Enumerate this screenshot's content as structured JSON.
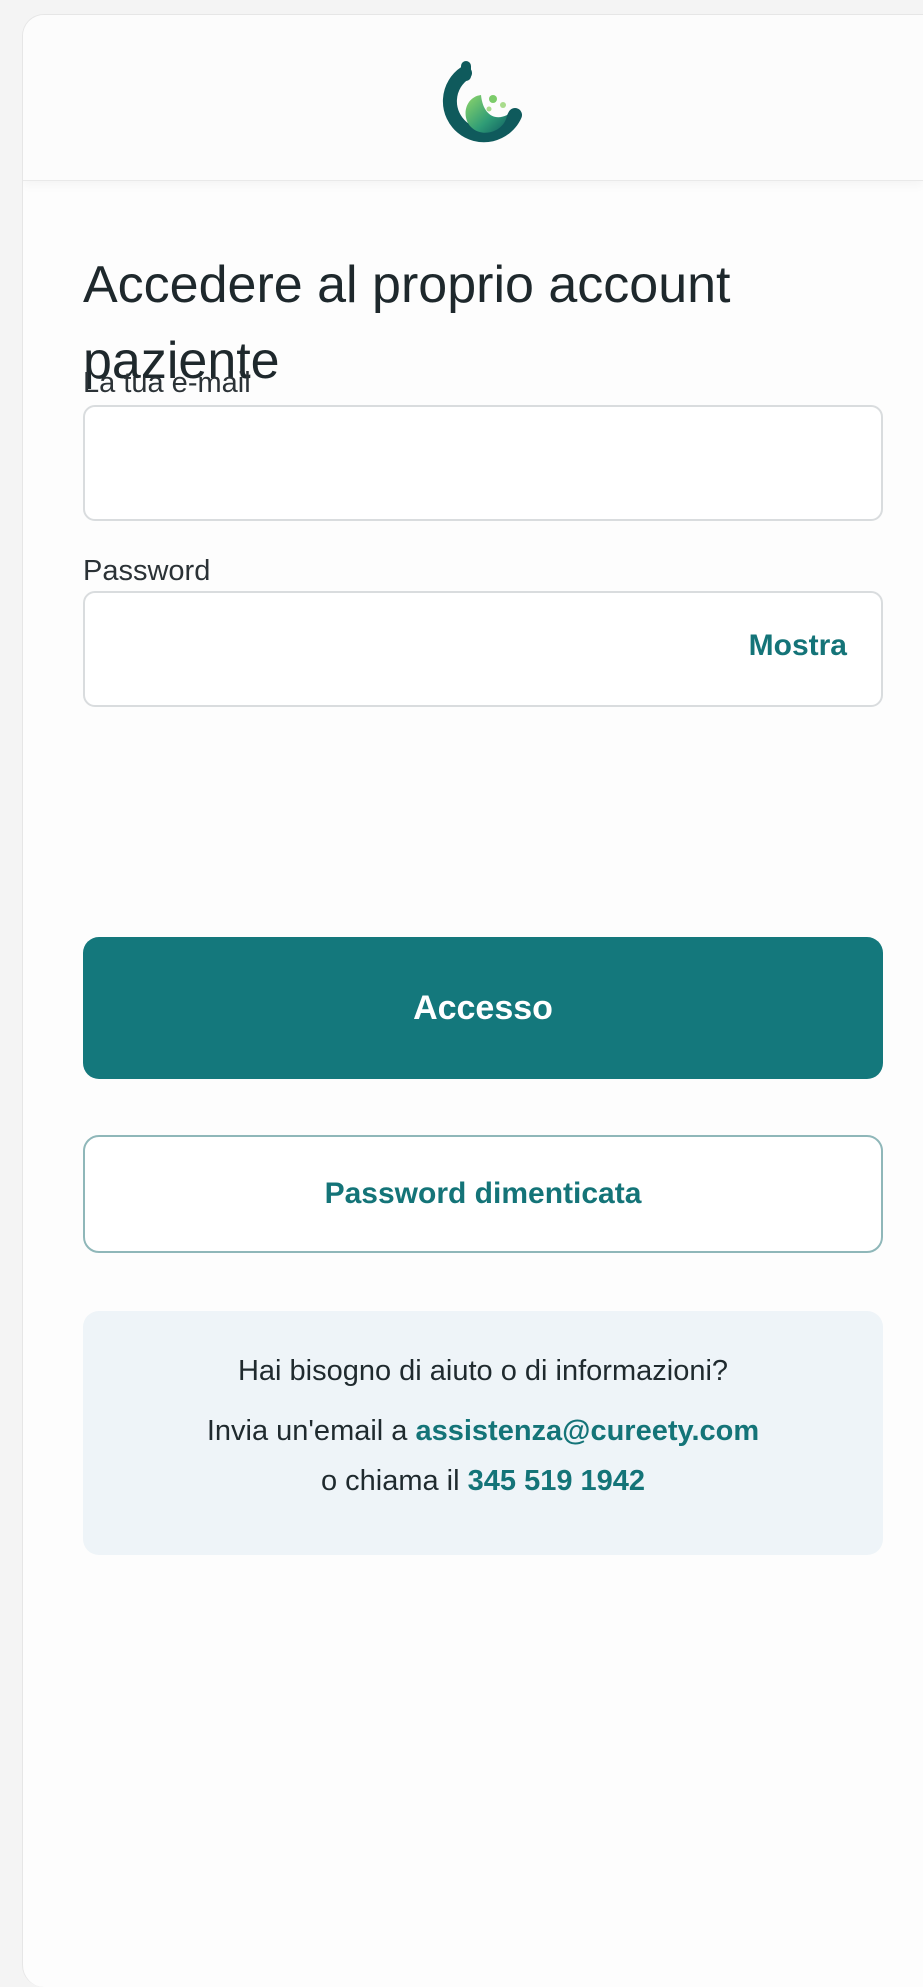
{
  "brand": {
    "logo_icon": "cureety-logo-icon",
    "accent_color": "#14787c",
    "help_bg": "#eef4f8"
  },
  "page": {
    "title": "Accedere al proprio account paziente"
  },
  "form": {
    "email_label": "La tua e-mail",
    "email_value": "",
    "password_label": "Password",
    "password_value": "",
    "show_password": "Mostra",
    "submit_label": "Accesso",
    "forgot_label": "Password dimenticata"
  },
  "help": {
    "question": "Hai bisogno di aiuto o di informazioni?",
    "email_prefix": "Invia un'email a ",
    "email": "assistenza@cureety.com",
    "phone_prefix": "o chiama il ",
    "phone": "345 519 1942"
  }
}
